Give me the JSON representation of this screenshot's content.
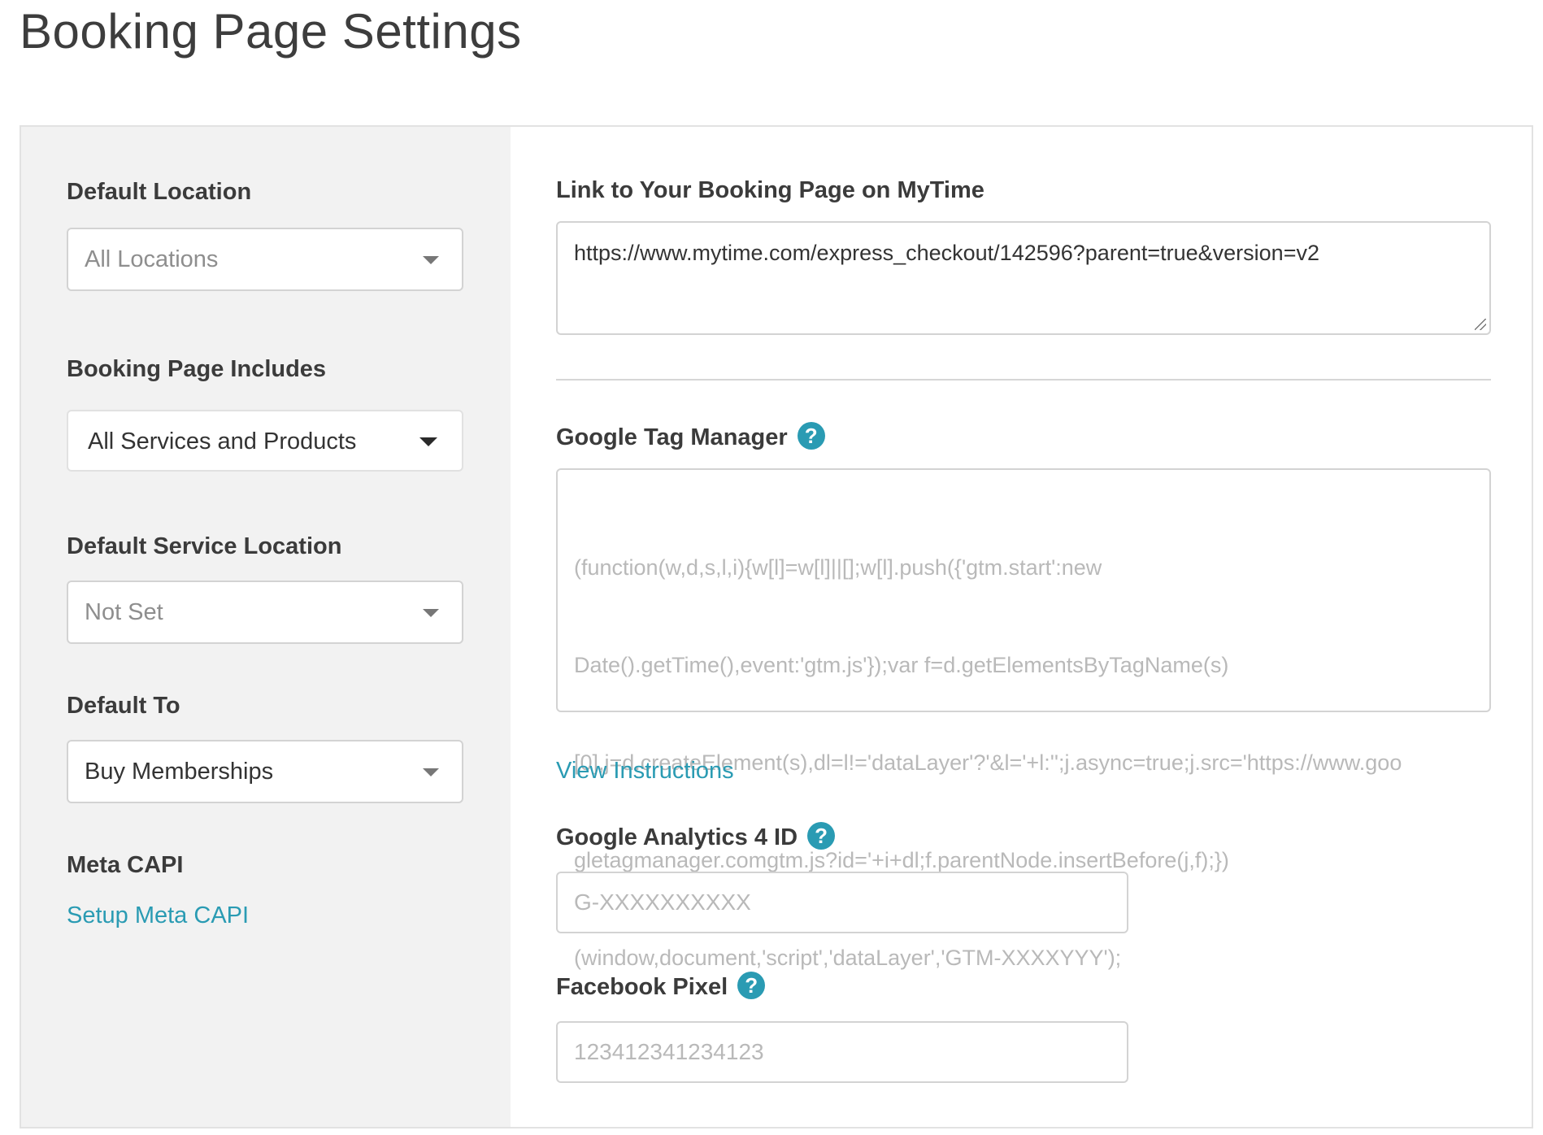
{
  "page": {
    "title": "Booking Page Settings"
  },
  "left": {
    "default_location": {
      "label": "Default Location",
      "value": "All Locations"
    },
    "booking_page_includes": {
      "label": "Booking Page Includes",
      "value": "All Services and Products"
    },
    "default_service_location": {
      "label": "Default Service Location",
      "value": "Not Set"
    },
    "default_to": {
      "label": "Default To",
      "value": "Buy Memberships"
    },
    "meta_capi": {
      "label": "Meta CAPI",
      "link": "Setup Meta CAPI"
    }
  },
  "right": {
    "booking_link": {
      "label": "Link to Your Booking Page on MyTime",
      "value": "https://www.mytime.com/express_checkout/142596?parent=true&version=v2"
    },
    "gtm": {
      "label": "Google Tag Manager",
      "help": "?",
      "placeholder_lines": [
        "(function(w,d,s,l,i){w[l]=w[l]||[];w[l].push({'gtm.start':new",
        "Date().getTime(),event:'gtm.js'});var f=d.getElementsByTagName(s)",
        "[0],j=d.createElement(s),dl=l!='dataLayer'?'&l='+l:'';j.async=true;j.src='https://www.goo",
        "gletagmanager.comgtm.js?id='+i+dl;f.parentNode.insertBefore(j,f);})",
        "(window,document,'script','dataLayer','GTM-XXXXYYY');"
      ],
      "instructions_link": "View Instructions"
    },
    "ga4": {
      "label": "Google Analytics 4 ID",
      "help": "?",
      "placeholder": "G-XXXXXXXXXX"
    },
    "facebook_pixel": {
      "label": "Facebook Pixel",
      "help": "?",
      "placeholder": "123412341234123"
    }
  },
  "colors": {
    "accent": "#2a9bb3",
    "left_panel_bg": "#f2f2f2"
  }
}
